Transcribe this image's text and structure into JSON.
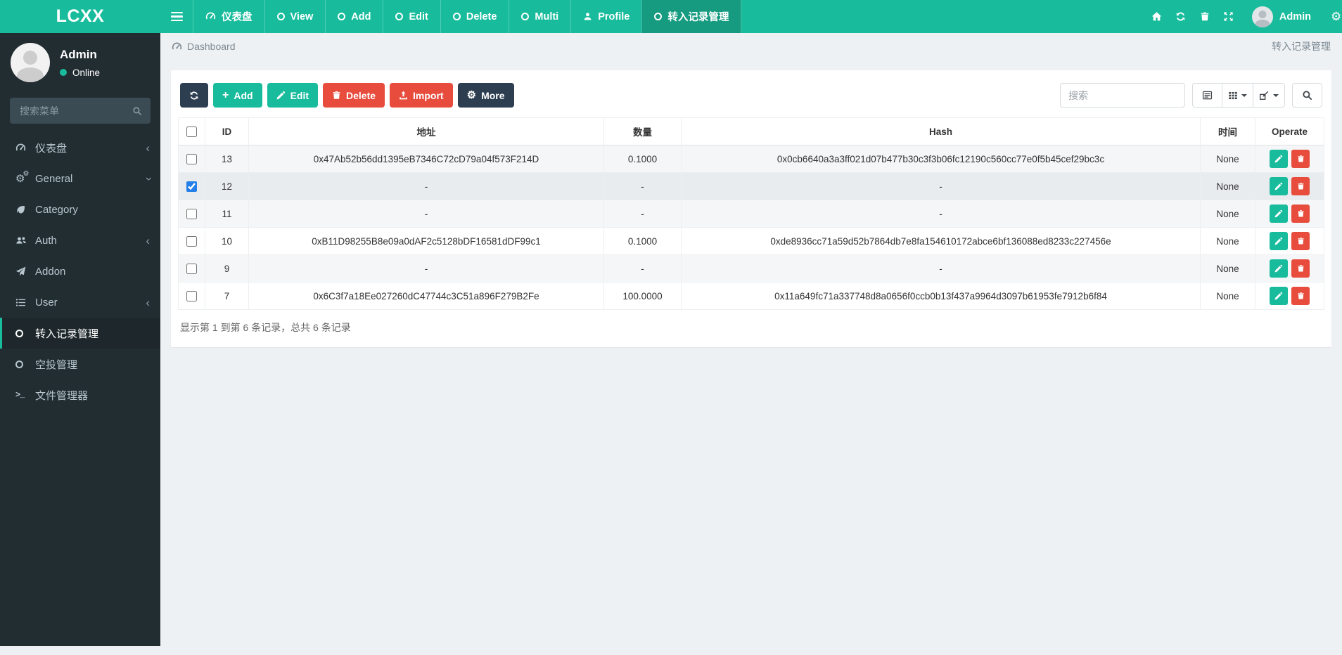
{
  "app": {
    "logo_text": "LCXX"
  },
  "sidebar": {
    "user": {
      "name": "Admin",
      "status": "Online"
    },
    "search_placeholder": "搜索菜单",
    "items": [
      {
        "label": "仪表盘",
        "icon": "tachometer-icon",
        "chevron": "left"
      },
      {
        "label": "General",
        "icon": "cogs-icon",
        "chevron": "down"
      },
      {
        "label": "Category",
        "icon": "leaf-icon",
        "chevron": "none"
      },
      {
        "label": "Auth",
        "icon": "users-icon",
        "chevron": "left"
      },
      {
        "label": "Addon",
        "icon": "send-icon",
        "chevron": "none"
      },
      {
        "label": "User",
        "icon": "list-icon",
        "chevron": "left"
      },
      {
        "label": "转入记录管理",
        "icon": "circle-o-icon",
        "chevron": "none",
        "active": true
      },
      {
        "label": "空投管理",
        "icon": "circle-o-icon",
        "chevron": "none"
      },
      {
        "label": "文件管理器",
        "icon": "terminal-icon",
        "chevron": "none"
      }
    ]
  },
  "topbar": {
    "tabs": [
      {
        "label": "仪表盘",
        "icon": "tachometer-icon"
      },
      {
        "label": "View",
        "icon": "circle-o-icon"
      },
      {
        "label": "Add",
        "icon": "circle-o-icon"
      },
      {
        "label": "Edit",
        "icon": "circle-o-icon"
      },
      {
        "label": "Delete",
        "icon": "circle-o-icon"
      },
      {
        "label": "Multi",
        "icon": "circle-o-icon"
      },
      {
        "label": "Profile",
        "icon": "user-icon"
      },
      {
        "label": "转入记录管理",
        "icon": "circle-o-icon",
        "active": true
      }
    ],
    "right_icons": [
      "home-icon",
      "refresh-icon",
      "trash-icon",
      "expand-icon"
    ],
    "username": "Admin"
  },
  "breadcrumb": {
    "current": "Dashboard",
    "page_title": "转入记录管理"
  },
  "toolbar": {
    "add_label": "Add",
    "edit_label": "Edit",
    "delete_label": "Delete",
    "import_label": "Import",
    "more_label": "More",
    "search_placeholder": "搜索"
  },
  "table": {
    "headers": {
      "id": "ID",
      "address": "地址",
      "amount": "数量",
      "hash": "Hash",
      "time": "时间",
      "operate": "Operate"
    },
    "rows": [
      {
        "id": "13",
        "address": "0x47Ab52b56dd1395eB7346C72cD79a04f573F214D",
        "amount": "0.1000",
        "hash": "0x0cb6640a3a3ff021d07b477b30c3f3b06fc12190c560cc77e0f5b45cef29bc3c",
        "time": "None",
        "checked": false
      },
      {
        "id": "12",
        "address": "-",
        "amount": "-",
        "hash": "-",
        "time": "None",
        "checked": true
      },
      {
        "id": "11",
        "address": "-",
        "amount": "-",
        "hash": "-",
        "time": "None",
        "checked": false
      },
      {
        "id": "10",
        "address": "0xB11D98255B8e09a0dAF2c5128bDF16581dDF99c1",
        "amount": "0.1000",
        "hash": "0xde8936cc71a59d52b7864db7e8fa154610172abce6bf136088ed8233c227456e",
        "time": "None",
        "checked": false
      },
      {
        "id": "9",
        "address": "-",
        "amount": "-",
        "hash": "-",
        "time": "None",
        "checked": false
      },
      {
        "id": "7",
        "address": "0x6C3f7a18Ee027260dC47744c3C51a896F279B2Fe",
        "amount": "100.0000",
        "hash": "0x11a649fc71a337748d8a0656f0ccb0b13f437a9964d3097b61953fe7912b6f84",
        "time": "None",
        "checked": false
      }
    ],
    "summary": "显示第 1 到第 6 条记录，总共 6 条记录"
  },
  "colors": {
    "accent_teal": "#18bc9c",
    "dark_navy": "#2c3e50",
    "danger_red": "#e74c3c",
    "sidebar_bg": "#222d32",
    "active_tab": "#169b80"
  }
}
